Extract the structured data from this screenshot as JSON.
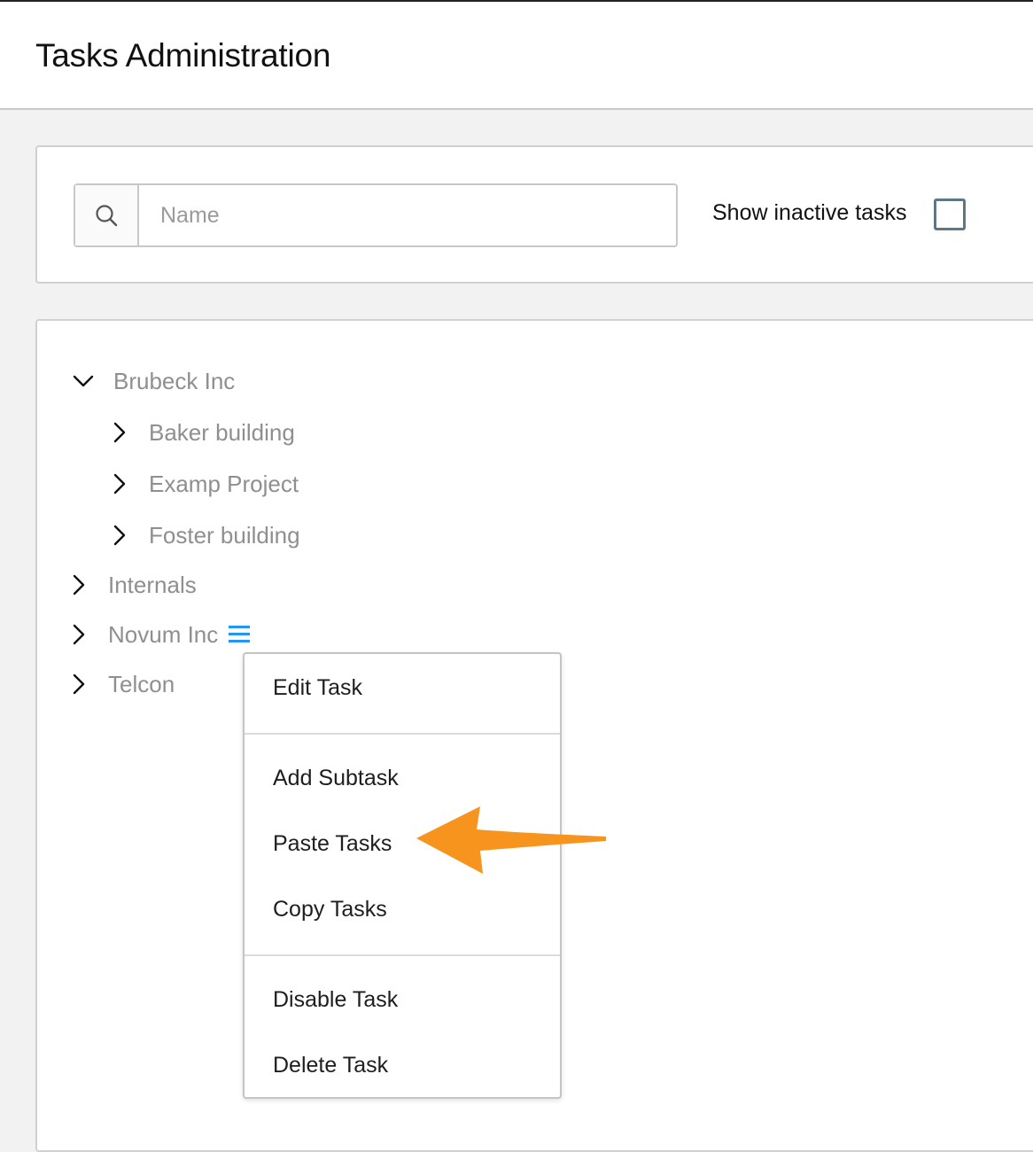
{
  "header": {
    "title": "Tasks Administration"
  },
  "filters": {
    "search_icon": "search-icon",
    "search_placeholder": "Name",
    "search_value": "",
    "show_inactive_label": "Show inactive tasks",
    "show_inactive_checked": false
  },
  "tree": {
    "nodes": [
      {
        "label": "Brubeck Inc",
        "expanded": true,
        "level": 0
      },
      {
        "label": "Baker building",
        "expanded": false,
        "level": 1
      },
      {
        "label": "Examp Project",
        "expanded": false,
        "level": 1
      },
      {
        "label": "Foster building",
        "expanded": false,
        "level": 1
      },
      {
        "label": "Internals",
        "expanded": false,
        "level": 0
      },
      {
        "label": "Novum Inc",
        "expanded": false,
        "level": 0,
        "menu_icon": "hamburger-menu-icon"
      },
      {
        "label": "Telcon",
        "expanded": false,
        "level": 0
      }
    ]
  },
  "context_menu": {
    "items": [
      {
        "label": "Edit Task"
      },
      {
        "label": "Add Subtask"
      },
      {
        "label": "Paste Tasks"
      },
      {
        "label": "Copy Tasks"
      },
      {
        "label": "Disable Task"
      },
      {
        "label": "Delete Task"
      }
    ]
  },
  "annotation": {
    "arrow_color": "#f7941d",
    "points_to": "Paste Tasks"
  },
  "colors": {
    "menu_icon": "#2196f3",
    "tree_label": "#8f8f8f",
    "checkbox_border": "#5f7785"
  }
}
